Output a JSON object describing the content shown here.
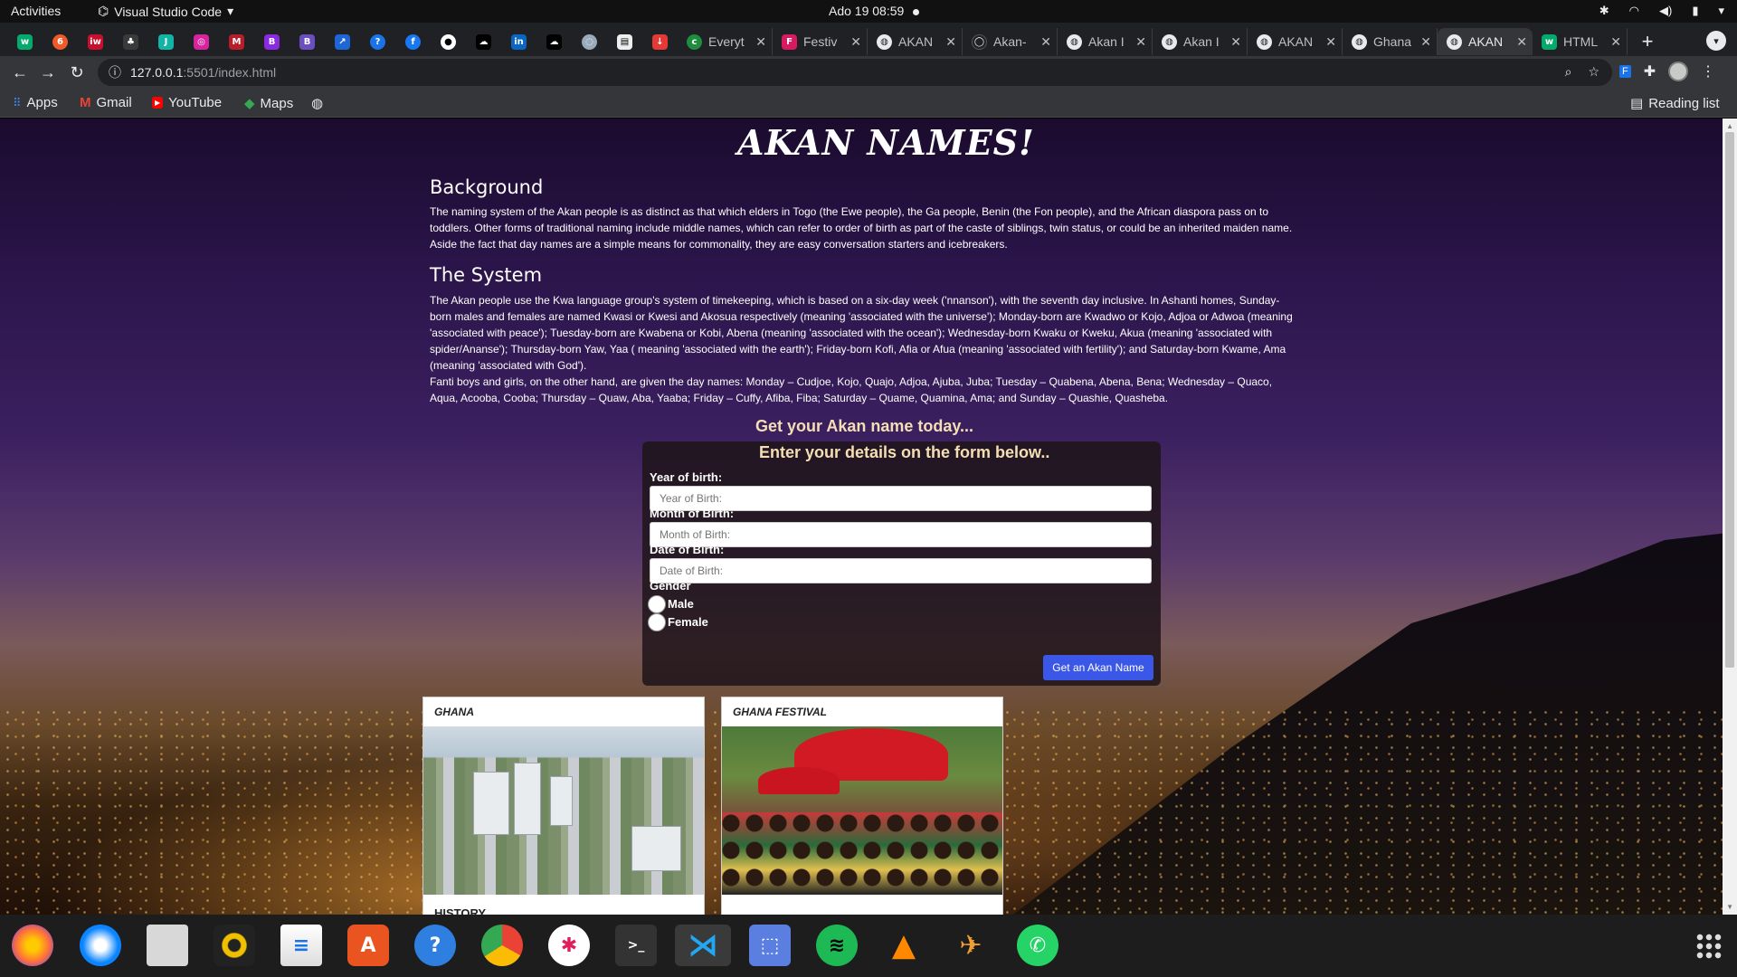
{
  "system_bar": {
    "activities": "Activities",
    "app_name": "Visual Studio Code",
    "clock": "Ado 19  08:59"
  },
  "browser": {
    "tabs": [
      {
        "label": "Everyt",
        "icon": "globe-icon"
      },
      {
        "label": "Festiv",
        "icon": "festival-favicon"
      },
      {
        "label": "AKAN",
        "icon": "globe-icon"
      },
      {
        "label": "Akan-",
        "icon": "github-icon"
      },
      {
        "label": "Akan I",
        "icon": "globe-icon"
      },
      {
        "label": "Akan I",
        "icon": "globe-icon"
      },
      {
        "label": "AKAN",
        "icon": "globe-icon"
      },
      {
        "label": "Ghana",
        "icon": "globe-icon"
      },
      {
        "label": "AKAN",
        "icon": "globe-icon"
      },
      {
        "label": "HTML",
        "icon": "w3schools-icon"
      }
    ],
    "url": "127.0.0.1",
    "url_path": ":5501/index.html",
    "bookmarks": {
      "apps": "Apps",
      "gmail": "Gmail",
      "youtube": "YouTube",
      "maps": "Maps",
      "reading_list": "Reading list"
    }
  },
  "page": {
    "title": "AKAN NAMES!",
    "background": {
      "heading": "Background",
      "text": "The naming system of the Akan people is as distinct as that which elders in Togo (the Ewe people), the Ga people, Benin (the Fon people), and the African diaspora pass on to toddlers. Other forms of traditional naming include middle names, which can refer to order of birth as part of the caste of siblings, twin status, or could be an inherited maiden name. Aside the fact that day names are a simple means for commonality, they are easy conversation starters and icebreakers."
    },
    "system": {
      "heading": "The System",
      "text1": "The Akan people use the Kwa language group's system of timekeeping, which is based on a six-day week ('nnanson'), with the seventh day inclusive. In Ashanti homes, Sunday-born males and females are named Kwasi or Kwesi and Akosua respectively (meaning 'associated with the universe'); Monday-born are Kwadwo or Kojo, Adjoa or Adwoa (meaning 'associated with peace'); Tuesday-born are Kwabena or Kobi, Abena (meaning 'associated with the ocean'); Wednesday-born Kwaku or Kweku, Akua (meaning 'associated with spider/Ananse'); Thursday-born Yaw, Yaa ( meaning 'associated with the earth'); Friday-born Kofi, Afia or Afua (meaning 'associated with fertility'); and Saturday-born Kwame, Ama (meaning 'associated with God').",
      "text2": "Fanti boys and girls, on the other hand, are given the day names: Monday – Cudjoe, Kojo, Quajo, Adjoa, Ajuba, Juba; Tuesday – Quabena, Abena, Bena; Wednesday – Quaco, Aqua, Acooba, Cooba; Thursday – Quaw, Aba, Yaaba; Friday – Cuffy, Afiba, Fiba; Saturday – Quame, Quamina, Ama; and Sunday – Quashie, Quasheba."
    },
    "cta": "Get your Akan name today...",
    "form": {
      "subtitle": "Enter your details on the form below..",
      "year_label": "Year of birth:",
      "year_placeholder": "Year of Birth:",
      "month_label": "Month of Birth:",
      "month_placeholder": "Month of Birth:",
      "date_label": "Date of Birth:",
      "date_placeholder": "Date of Birth:",
      "gender_label": "Gender",
      "male_label": "Male",
      "female_label": "Female",
      "submit_label": "Get an Akan Name"
    },
    "cards": [
      {
        "caption": "GHANA",
        "footer": "HISTORY"
      },
      {
        "caption": "GHANA FESTIVAL"
      }
    ]
  },
  "dock": {
    "apps": [
      "firefox-icon",
      "thunderbird-icon",
      "files-icon",
      "rhythmbox-icon",
      "writer-icon",
      "software-icon",
      "help-icon",
      "chrome-icon",
      "slack-icon",
      "terminal-icon",
      "vscode-icon",
      "screenshot-icon",
      "spotify-icon",
      "vlc-icon",
      "bird-icon",
      "whatsapp-icon"
    ]
  }
}
